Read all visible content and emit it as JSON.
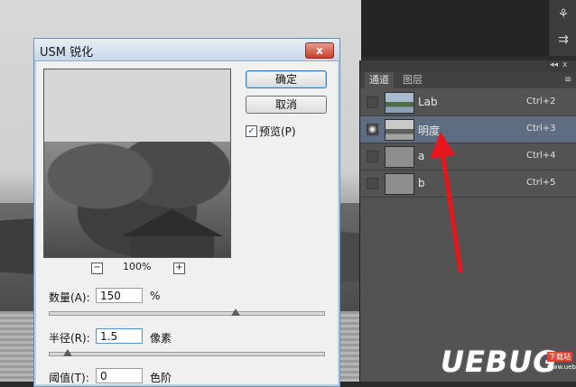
{
  "dialog": {
    "title": "USM 锐化",
    "close_glyph": "x",
    "ok_label": "确定",
    "cancel_label": "取消",
    "preview_checkbox_label": "预览(P)",
    "preview_checked": true,
    "zoom_level": "100%",
    "zoom_out_glyph": "−",
    "zoom_in_glyph": "+",
    "params": [
      {
        "label": "数量(A):",
        "value": "150",
        "unit": "%",
        "slider_fraction": 0.68
      },
      {
        "label": "半径(R):",
        "value": "1.5",
        "unit": "像素",
        "slider_fraction": 0.07
      },
      {
        "label": "阈值(T):",
        "value": "0",
        "unit": "色阶"
      }
    ]
  },
  "panel": {
    "tabs": [
      {
        "label": "通道",
        "active": true
      },
      {
        "label": "图层",
        "active": false
      }
    ],
    "collapse_glyph": "◂◂",
    "close_glyph": "x",
    "menu_glyph": "≡",
    "channels": [
      {
        "name": "Lab",
        "shortcut": "Ctrl+2",
        "visible": false,
        "selected": false,
        "thumb": "color"
      },
      {
        "name": "明度",
        "shortcut": "Ctrl+3",
        "visible": true,
        "selected": true,
        "thumb": "gray"
      },
      {
        "name": "a",
        "shortcut": "Ctrl+4",
        "visible": false,
        "selected": false,
        "thumb": "flat"
      },
      {
        "name": "b",
        "shortcut": "Ctrl+5",
        "visible": false,
        "selected": false,
        "thumb": "flat"
      }
    ]
  },
  "toolstrip": {
    "icons": [
      "brush-preset-icon",
      "adjust-icon"
    ]
  },
  "watermark": {
    "text": "UEBUG",
    "badge": "下载站",
    "domain": "www.uebug.com"
  },
  "colors": {
    "accent_arrow": "#e8161c",
    "panel_bg": "#535353",
    "selected_row": "#5f6d82"
  }
}
